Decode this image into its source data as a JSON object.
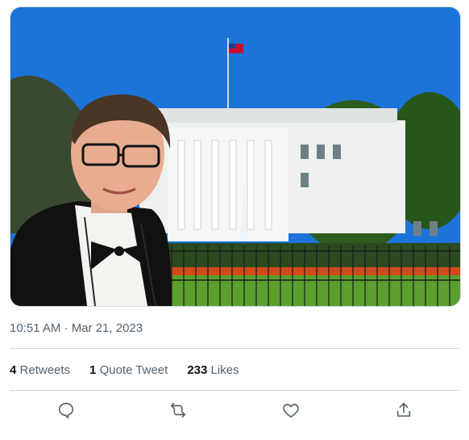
{
  "tweet": {
    "timestamp": "10:51 AM · Mar 21, 2023",
    "stats": {
      "retweets_count": "4",
      "retweets_label": "Retweets",
      "quotes_count": "1",
      "quotes_label": "Quote Tweet",
      "likes_count": "233",
      "likes_label": "Likes"
    },
    "actions": [
      "reply-icon",
      "retweet-icon",
      "like-icon",
      "share-icon"
    ]
  },
  "colors": {
    "text_secondary": "#536471",
    "divider": "#cfd9de",
    "icon": "#536471"
  }
}
